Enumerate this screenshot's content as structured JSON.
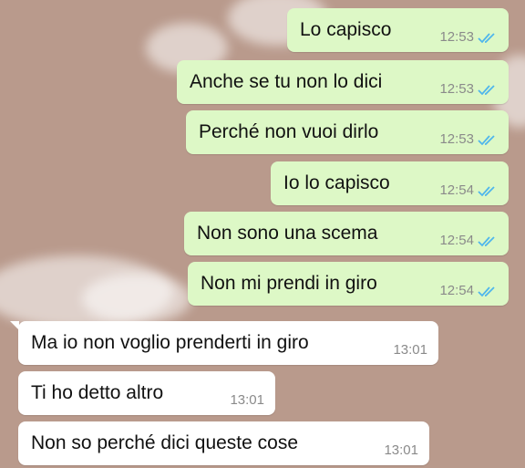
{
  "messages": [
    {
      "direction": "outgoing",
      "text": "Lo capisco",
      "time": "12:53",
      "status": "read"
    },
    {
      "direction": "outgoing",
      "text": "Anche se tu non lo dici",
      "time": "12:53",
      "status": "read"
    },
    {
      "direction": "outgoing",
      "text": "Perché non vuoi dirlo",
      "time": "12:53",
      "status": "read"
    },
    {
      "direction": "outgoing",
      "text": "Io lo capisco",
      "time": "12:54",
      "status": "read"
    },
    {
      "direction": "outgoing",
      "text": "Non sono una scema",
      "time": "12:54",
      "status": "read"
    },
    {
      "direction": "outgoing",
      "text": "Non mi prendi in giro",
      "time": "12:54",
      "status": "read"
    },
    {
      "direction": "incoming",
      "text": "Ma io non voglio prenderti in giro",
      "time": "13:01"
    },
    {
      "direction": "incoming",
      "text": "Ti ho detto altro",
      "time": "13:01"
    },
    {
      "direction": "incoming",
      "text": "Non so perché dici queste cose",
      "time": "13:01"
    }
  ],
  "colors": {
    "wallpaper": "#b99a8c",
    "outgoing_bubble": "#ddf8c6",
    "incoming_bubble": "#ffffff",
    "read_ticks": "#4fb6ec",
    "timestamp": "#8a8a8a"
  },
  "icons": {
    "read_status": "double-check-icon"
  }
}
